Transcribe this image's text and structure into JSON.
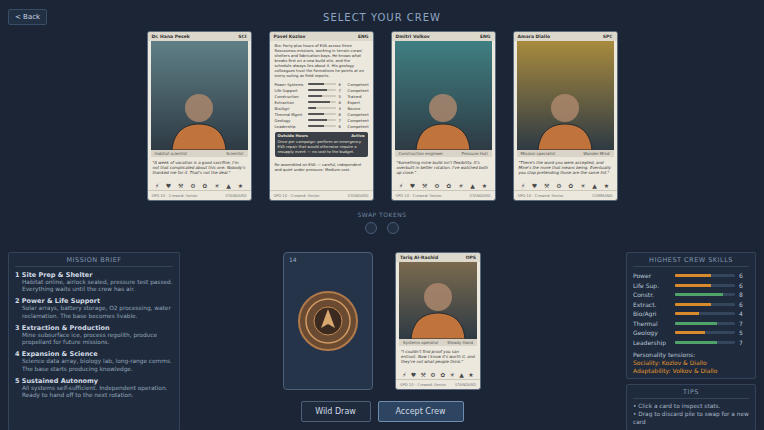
{
  "header": {
    "back": "< Back",
    "title": "SELECT YOUR CREW"
  },
  "stat_icons": [
    "⚡",
    "♥",
    "⚒",
    "⚙",
    "✿",
    "☀",
    "▲",
    "★"
  ],
  "crew": [
    {
      "kind": "portrait",
      "name": "Dr. Hana Pesek",
      "tag": "SCI",
      "role": "Habitat scientist",
      "badge": "Scientist",
      "quote": "\"A week of vacation is a good sacrifice, I'm not that complicated about this one. Nobody's thanked me for it. That's not the deal.\"",
      "footer": "SPD 10 · Crewed: Senior",
      "footer_right": "STANDARD",
      "color": "#5f7f86"
    },
    {
      "kind": "stats",
      "name": "Pavel Kozlov",
      "tag": "ENG",
      "bio": "Bio: Forty-plus hours of EVA across three Roscosmos missions, working in terrain crews' shelters and fabrication bays. He knows what breaks first on a new build site, and the schedule always lies about it. His geology colleagues trust the formations he points at on every outing as field reports.",
      "stats": [
        {
          "label": "Power Systems",
          "value": "6",
          "rating": "Competent",
          "level": 0.6
        },
        {
          "label": "Life Support",
          "value": "7",
          "rating": "Competent",
          "level": 0.7
        },
        {
          "label": "Construction",
          "value": "5",
          "rating": "Trained",
          "level": 0.5
        },
        {
          "label": "Extraction",
          "value": "8",
          "rating": "Expert",
          "level": 0.8
        },
        {
          "label": "Bio/Agri",
          "value": "3",
          "rating": "Novice",
          "level": 0.3
        },
        {
          "label": "Thermal Mgmt",
          "value": "6",
          "rating": "Competent",
          "level": 0.6
        },
        {
          "label": "Geology",
          "value": "7",
          "rating": "Competent",
          "level": 0.7
        },
        {
          "label": "Leadership",
          "value": "6",
          "rating": "Competent",
          "level": 0.6
        }
      ],
      "box": {
        "title": "Outside Hours",
        "button": "Active",
        "text": "Once per campaign: perform an emergency EVA repair that would otherwise require a resupply event — no cost to the budget."
      },
      "note": "Re-assembled on EVA — careful, independent and quiet under pressure. Medium cost.",
      "footer": "SPD 10 · Crewed: Senior",
      "footer_right": "STANDARD"
    },
    {
      "kind": "portrait",
      "name": "Dmitri Volkov",
      "tag": "ENG",
      "role": "Construction engineer",
      "badge": "Pressure Hull",
      "quote": "\"Something mine build isn't flexibility. It's overbuilt in better rotation. I've watched both up close.\"",
      "footer": "SPD 10 · Crewed: Senior",
      "footer_right": "STANDARD",
      "color": "#3f7f82"
    },
    {
      "kind": "portrait",
      "name": "Amara Diallo",
      "tag": "SPC",
      "role": "Mission specialist",
      "badge": "Wander Mind",
      "quote": "\"There's the word you were accepted, and Mine's the more that means being. Eventually you stop pretending those are the same list.\"",
      "footer": "SPD 10 · Crewed: Senior",
      "footer_right": "COMMAND",
      "color": "#a88a3e"
    }
  ],
  "swap_tokens": {
    "label": "SWAP TOKENS",
    "tokens": [
      {
        "used": false
      },
      {
        "used": false
      }
    ]
  },
  "mission_brief": {
    "title": "MISSION BRIEF",
    "phases": [
      {
        "number": "1",
        "title": "Site Prep & Shelter",
        "text": "Habitat online, airlock sealed, pressure test passed. Everything waits until the crew has air."
      },
      {
        "number": "2",
        "title": "Power & Life Support",
        "text": "Solar arrays, battery storage, O2 processing, water reclamation. The base becomes livable."
      },
      {
        "number": "3",
        "title": "Extraction & Production",
        "text": "Mine subsurface ice, process regolith, produce propellant for future missions."
      },
      {
        "number": "4",
        "title": "Expansion & Science",
        "text": "Science data array, biology lab, long-range comms. The base starts producing knowledge."
      },
      {
        "number": "5",
        "title": "Sustained Autonomy",
        "text": "All systems self-sufficient. Independent operation. Ready to hand off to the next rotation."
      }
    ]
  },
  "deck": {
    "count": "14"
  },
  "drawn_card": {
    "kind": "portrait",
    "name": "Tariq Al-Rashid",
    "tag": "OPS",
    "role": "Systems operator",
    "badge": "Steady Hand",
    "quote": "\"I couldn't find proof you can entrust. Now I know it's worth it, and they're not what people think.\"",
    "footer": "SPD 10 · Crewed: Senior",
    "footer_right": "STANDARD",
    "color": "#7a6a4e"
  },
  "buttons": [
    {
      "label": "Wild Draw",
      "primary": false
    },
    {
      "label": "Accept Crew",
      "primary": true
    }
  ],
  "skills": {
    "title": "HIGHEST CREW SKILLS",
    "rows": [
      {
        "label": "Power",
        "value": "6",
        "level": 0.6,
        "color": "#d98b2b"
      },
      {
        "label": "Life Sup.",
        "value": "6",
        "level": 0.6,
        "color": "#d98b2b"
      },
      {
        "label": "Constr.",
        "value": "8",
        "level": 0.8,
        "color": "#4fa36a"
      },
      {
        "label": "Extract.",
        "value": "6",
        "level": 0.6,
        "color": "#d98b2b"
      },
      {
        "label": "Bio/Agri",
        "value": "4",
        "level": 0.4,
        "color": "#d98b2b"
      },
      {
        "label": "Thermal",
        "value": "7",
        "level": 0.7,
        "color": "#4fa36a"
      },
      {
        "label": "Geology",
        "value": "5",
        "level": 0.5,
        "color": "#d98b2b"
      },
      {
        "label": "Leadership",
        "value": "7",
        "level": 0.7,
        "color": "#4fa36a"
      }
    ],
    "tensions_title": "Personality tensions:",
    "tensions": [
      "Sociality: Kozlov & Diallo",
      "Adaptability: Volkov & Diallo"
    ]
  },
  "tips": {
    "title": "TIPS",
    "items": [
      "• Click a card to inspect stats.",
      "• Drag to discard pile to swap for a new card"
    ]
  }
}
